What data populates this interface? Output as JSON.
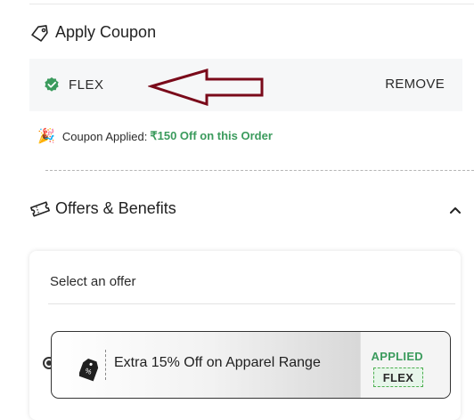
{
  "apply_coupon": {
    "title": "Apply Coupon",
    "applied_code": "FLEX",
    "remove_label": "REMOVE",
    "applied_message_prefix": "Coupon Applied:",
    "applied_amount": "₹150 Off on this Order"
  },
  "offers": {
    "title": "Offers & Benefits",
    "select_label": "Select an offer",
    "items": [
      {
        "text": "Extra 15% Off on Apparel Range",
        "status": "APPLIED",
        "code": "FLEX",
        "selected": true
      }
    ]
  },
  "colors": {
    "success_green": "#3b9b5d",
    "annotation_arrow": "#7a0a1a",
    "panel_bg": "#f6f7f8"
  },
  "icons": {
    "coupon": "tag-icon",
    "check": "check-badge-icon",
    "party": "party-popper-icon",
    "offers": "ticket-icon",
    "collapse": "chevron-up-icon",
    "offer_item": "price-tag-icon"
  }
}
